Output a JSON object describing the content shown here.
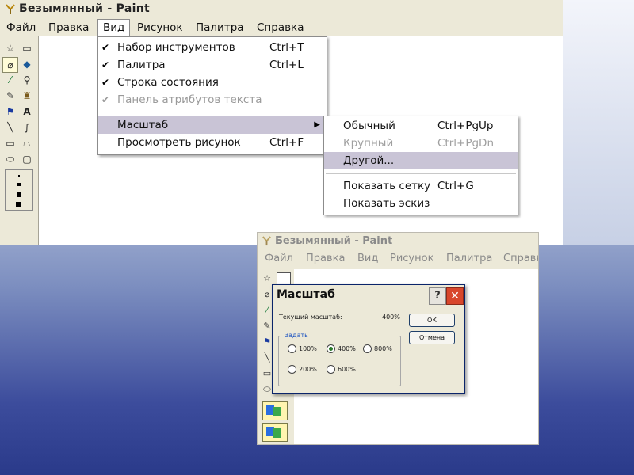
{
  "main_window": {
    "title": "Безымянный - Paint",
    "menu": [
      "Файл",
      "Правка",
      "Вид",
      "Рисунок",
      "Палитра",
      "Справка"
    ],
    "view_menu": {
      "items": [
        {
          "check": "✔",
          "label": "Набор инструментов",
          "shortcut": "Ctrl+T",
          "enabled": true
        },
        {
          "check": "✔",
          "label": "Палитра",
          "shortcut": "Ctrl+L",
          "enabled": true
        },
        {
          "check": "✔",
          "label": "Строка состояния",
          "shortcut": "",
          "enabled": true
        },
        {
          "check": "✔",
          "label": "Панель атрибутов текста",
          "shortcut": "",
          "enabled": false
        },
        {
          "check": "",
          "label": "Масштаб",
          "shortcut": "",
          "enabled": true
        },
        {
          "check": "",
          "label": "Просмотреть рисунок",
          "shortcut": "Ctrl+F",
          "enabled": true
        }
      ],
      "submenu_arrow": "▶"
    },
    "zoom_submenu": {
      "items": [
        {
          "label": "Обычный",
          "shortcut": "Ctrl+PgUp",
          "enabled": true
        },
        {
          "label": "Крупный",
          "shortcut": "Ctrl+PgDn",
          "enabled": false
        },
        {
          "label": "Другой...",
          "shortcut": "",
          "enabled": true
        },
        {
          "label": "Показать сетку",
          "shortcut": "Ctrl+G",
          "enabled": true
        },
        {
          "label": "Показать эскиз",
          "shortcut": "",
          "enabled": true
        }
      ]
    }
  },
  "second_window": {
    "title": "Безымянный - Paint",
    "menu": [
      "Файл",
      "Правка",
      "Вид",
      "Рисунок",
      "Палитра",
      "Справка"
    ]
  },
  "zoom_dialog": {
    "title": "Масштаб",
    "current_label": "Текущий масштаб:",
    "current_value": "400%",
    "group_label": "Задать",
    "options": [
      "100%",
      "400%",
      "800%",
      "200%",
      "600%"
    ],
    "selected": "400%",
    "ok_label": "ОК",
    "cancel_label": "Отмена",
    "help_glyph": "?",
    "close_glyph": "✕"
  }
}
